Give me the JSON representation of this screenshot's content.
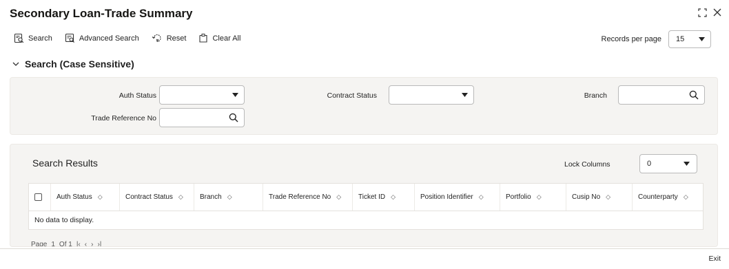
{
  "title": "Secondary Loan-Trade Summary",
  "toolbar": {
    "search_label": "Search",
    "advanced_search_label": "Advanced Search",
    "reset_label": "Reset",
    "clear_all_label": "Clear All"
  },
  "records_per_page": {
    "label": "Records per page",
    "value": "15"
  },
  "search_section": {
    "title": "Search (Case Sensitive)",
    "fields": {
      "auth_status": {
        "label": "Auth Status",
        "value": ""
      },
      "contract_status": {
        "label": "Contract Status",
        "value": ""
      },
      "branch": {
        "label": "Branch",
        "value": ""
      },
      "trade_reference_no": {
        "label": "Trade Reference No",
        "value": ""
      }
    }
  },
  "results": {
    "title": "Search Results",
    "lock_columns_label": "Lock Columns",
    "lock_columns_value": "0",
    "columns": [
      "Auth Status",
      "Contract Status",
      "Branch",
      "Trade Reference No",
      "Ticket ID",
      "Position Identifier",
      "Portfolio",
      "Cusip No",
      "Counterparty"
    ],
    "empty_message": "No data to display.",
    "pager": {
      "page_label": "Page",
      "page_value": "1",
      "of_label": "Of 1"
    }
  },
  "footer": {
    "exit_label": "Exit"
  },
  "icons": {
    "search": "magnifier-icon",
    "dropdown": "chevron-down-icon",
    "sort": "sort-icon",
    "maximize": "maximize-icon",
    "close": "close-icon"
  }
}
